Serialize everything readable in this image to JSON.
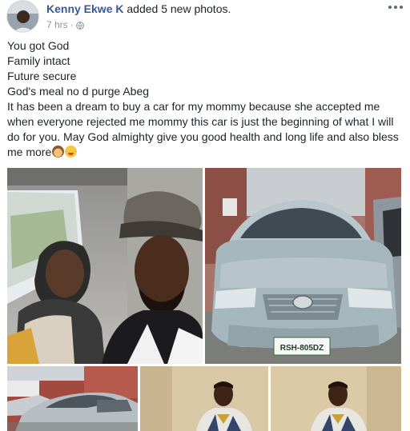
{
  "post": {
    "author": "Kenny Ekwe K",
    "action": "added 5 new photos.",
    "timestamp": "7 hrs",
    "separator": "·",
    "privacy_icon": "globe-icon",
    "more_icon": "more-options-icon"
  },
  "text": {
    "lines": [
      "You got God",
      "Family intact",
      "Future secure",
      "God's meal no d purge Abeg"
    ],
    "paragraph": "It has been a dream to buy a car for my mommy because she accepted me when everyone rejected me mommy this car is just the beginning of what I will do for you. May God almighty give you good health and long life and also bless me more",
    "emojis": [
      "older-woman-emoji",
      "winking-tongue-emoji"
    ]
  },
  "photos": {
    "plate_text": "RSH-805DZ",
    "items": [
      {
        "id": "photo-1",
        "subject": "selfie-in-car"
      },
      {
        "id": "photo-2",
        "subject": "silver-toyota-camry-front"
      },
      {
        "id": "photo-3",
        "subject": "silver-car-side"
      },
      {
        "id": "photo-4",
        "subject": "man-standing-portrait"
      },
      {
        "id": "photo-5",
        "subject": "man-standing-portrait"
      }
    ]
  },
  "colors": {
    "link": "#365899",
    "text": "#1d2129",
    "meta": "#90949c"
  }
}
